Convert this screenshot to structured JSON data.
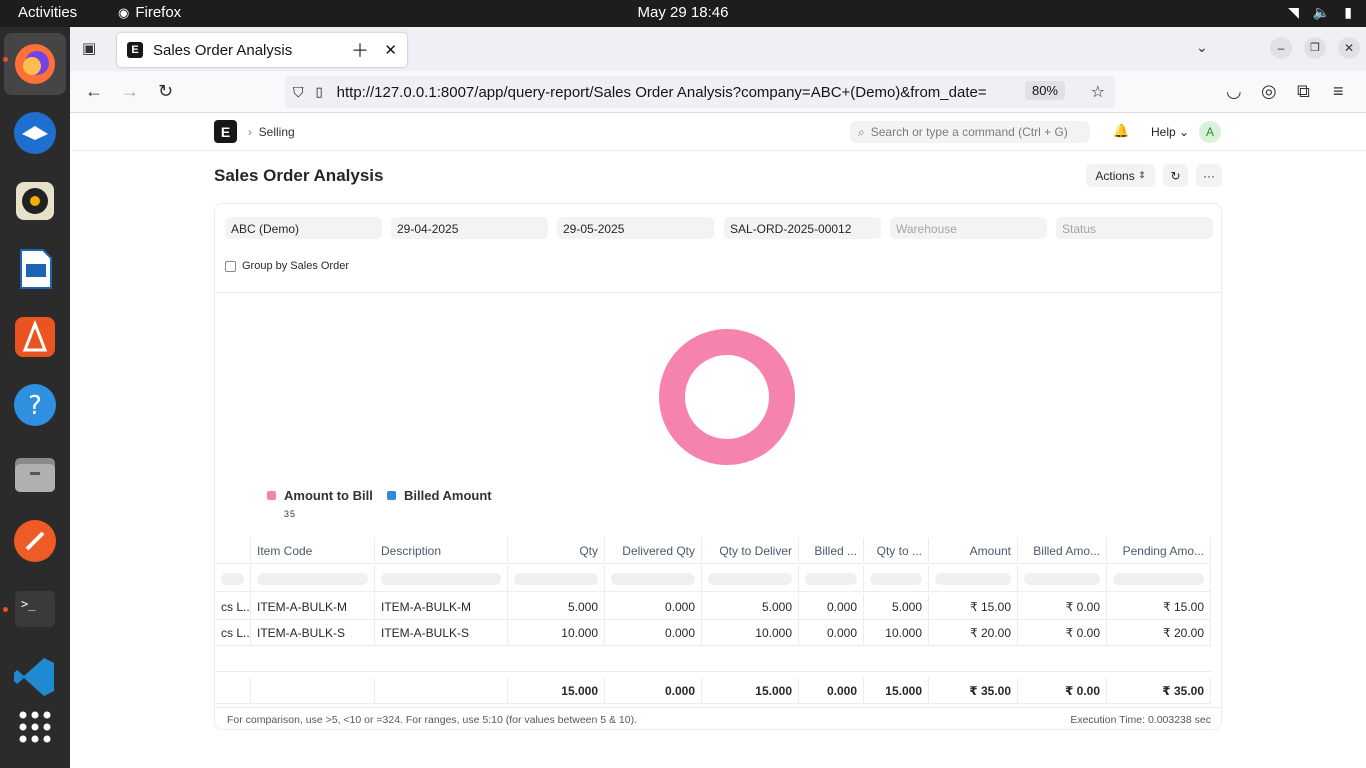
{
  "system": {
    "activities": "Activities",
    "app_name": "Firefox",
    "clock": "May 29  18:46"
  },
  "browser": {
    "tab_title": "Sales Order Analysis",
    "url": "http://127.0.0.1:8007/app/query-report/Sales Order Analysis?company=ABC+(Demo)&from_date=",
    "zoom": "80%"
  },
  "app": {
    "logo": "E",
    "breadcrumb": "Selling",
    "search_placeholder": "Search or type a command (Ctrl + G)",
    "help": "Help",
    "avatar": "A"
  },
  "page": {
    "title": "Sales Order Analysis",
    "actions_label": "Actions"
  },
  "filters": {
    "company": "ABC (Demo)",
    "from_date": "29-04-2025",
    "to_date": "29-05-2025",
    "sales_order": "SAL-ORD-2025-00012",
    "warehouse_placeholder": "Warehouse",
    "status_placeholder": "Status",
    "group_by_label": "Group by Sales Order"
  },
  "chart_data": {
    "type": "pie",
    "categories": [
      "Amount to Bill",
      "Billed Amount"
    ],
    "values": [
      35,
      0
    ],
    "colors": [
      "#f683ae",
      "#318ad8"
    ],
    "value_label": "35"
  },
  "table": {
    "columns": [
      "",
      "Item Code",
      "Description",
      "Qty",
      "Delivered Qty",
      "Qty to Deliver",
      "Billed ...",
      "Qty to ...",
      "Amount",
      "Billed Amo...",
      "Pending Amo..."
    ],
    "rows": [
      [
        "cs L...",
        "ITEM-A-BULK-M",
        "ITEM-A-BULK-M",
        "5.000",
        "0.000",
        "5.000",
        "0.000",
        "5.000",
        "₹ 15.00",
        "₹ 0.00",
        "₹ 15.00"
      ],
      [
        "cs L...",
        "ITEM-A-BULK-S",
        "ITEM-A-BULK-S",
        "10.000",
        "0.000",
        "10.000",
        "0.000",
        "10.000",
        "₹ 20.00",
        "₹ 0.00",
        "₹ 20.00"
      ]
    ],
    "totals": [
      "",
      "",
      "",
      "15.000",
      "0.000",
      "15.000",
      "0.000",
      "15.000",
      "₹ 35.00",
      "₹ 0.00",
      "₹ 35.00"
    ]
  },
  "footer": {
    "hint": "For comparison, use >5, <10 or =324. For ranges, use 5:10 (for values between 5 & 10).",
    "execution_time": "Execution Time: 0.003238 sec"
  }
}
